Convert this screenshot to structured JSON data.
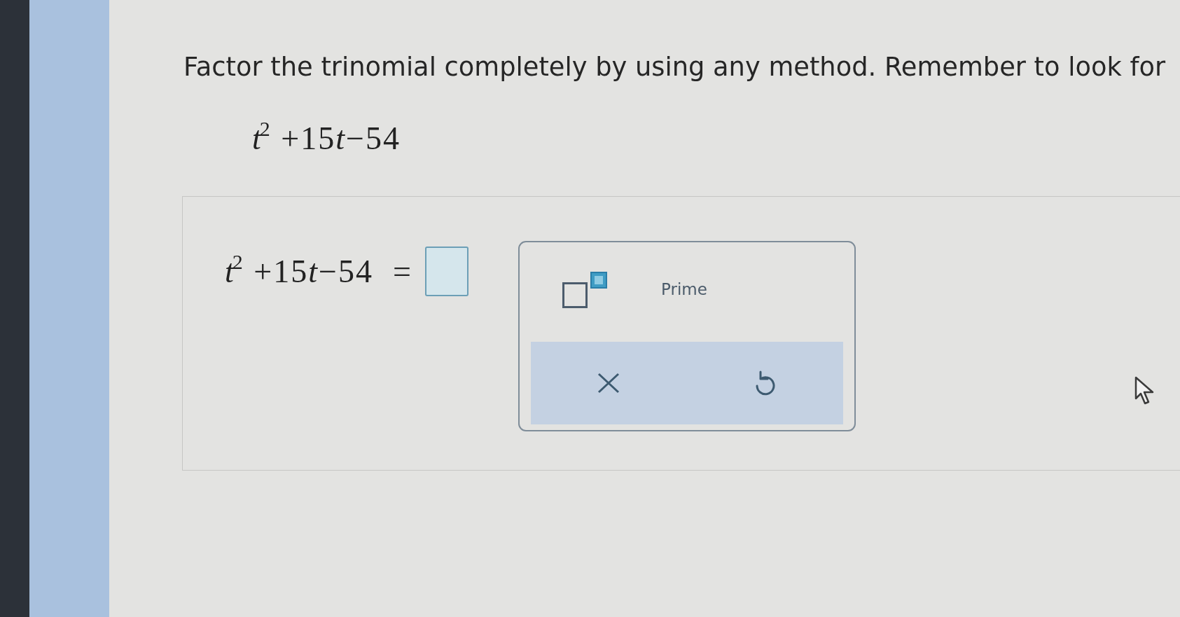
{
  "question": {
    "instruction": "Factor the trinomial completely by using any method. Remember to look for",
    "expression": [
      "*t*$^{2}$ +15",
      "*t*",
      "−54"
    ]
  },
  "answer": {
    "expression": [
      "*t*$^{2}$ +15",
      "*t*",
      "−54"
    ],
    "relation": "="
  },
  "palette": {
    "tools": [
      {
        "kind": "superscript"
      },
      {
        "kind": "text",
        "label": "Prime"
      }
    ],
    "actions": [
      {
        "kind": "clear"
      },
      {
        "kind": "undo"
      }
    ]
  }
}
